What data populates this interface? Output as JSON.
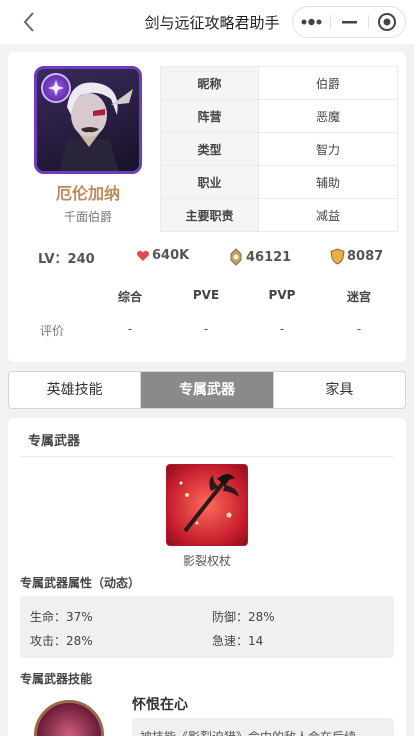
{
  "nav": {
    "title": "剑与远征攻略君助手",
    "back_icon": "chevron-left-icon",
    "more_icon": "more-dots-icon",
    "minimize_icon": "minimize-icon",
    "close_icon": "target-close-icon"
  },
  "hero": {
    "name": "厄伦加纳",
    "subtitle": "千面伯爵",
    "name_color": "#c08a5a",
    "frame_color": "#6e3cc0",
    "attributes": [
      {
        "key": "昵称",
        "value": "伯爵"
      },
      {
        "key": "阵营",
        "value": "恶魔"
      },
      {
        "key": "类型",
        "value": "智力"
      },
      {
        "key": "职业",
        "value": "辅助"
      },
      {
        "key": "主要职责",
        "value": "减益"
      }
    ]
  },
  "stats": {
    "level": "LV：240",
    "hp": "640K",
    "attack": "46121",
    "defense": "8087"
  },
  "ratings": {
    "row_label": "评价",
    "headers": [
      "综合",
      "PVE",
      "PVP",
      "迷宫"
    ],
    "values": [
      "-",
      "-",
      "-",
      "-"
    ]
  },
  "tabs": [
    {
      "label": "英雄技能",
      "active": false
    },
    {
      "label": "专属武器",
      "active": true
    },
    {
      "label": "家具",
      "active": false
    }
  ],
  "weapon": {
    "section_title": "专属武器",
    "name": "影裂权杖",
    "props_title": "专属武器属性（动态）",
    "props": [
      {
        "text": "生命：37%"
      },
      {
        "text": "防御：28%"
      },
      {
        "text": "攻击：28%"
      },
      {
        "text": "急速：14"
      }
    ],
    "skill_title": "专属武器技能",
    "skill_name": "怀恨在心",
    "skill_desc": "被技能《影裂迫猎》命中的敌人会在后续"
  }
}
